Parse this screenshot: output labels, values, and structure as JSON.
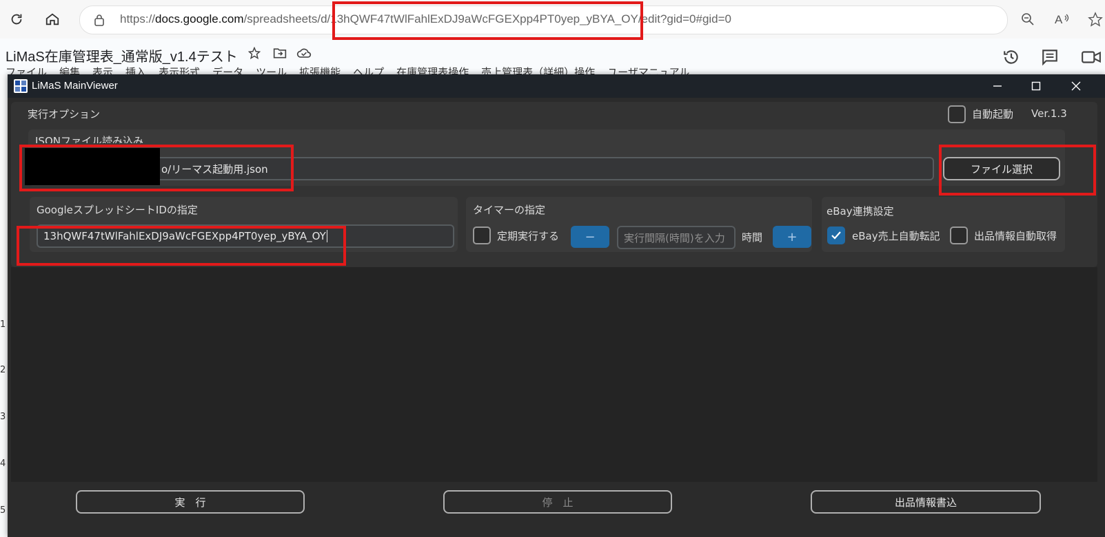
{
  "browser": {
    "url_prefix": "https://",
    "url_domain": "docs.google.com",
    "url_path_a": "/spreadsheets/d",
    "url_path_b": "/13hQWF47tWlFahlExDJ9aWcFGEXpp4PT0yep_yBYA_OY/edit?gid=0#gid=0",
    "icons": [
      "refresh-icon",
      "home-icon",
      "lock-icon",
      "zoom-out-icon",
      "read-aloud-icon",
      "favorite-icon"
    ]
  },
  "sheets": {
    "title": "LiMaS在庫管理表_通常版_v1.4テスト",
    "menu": [
      "ファイル",
      "編集",
      "表示",
      "挿入",
      "表示形式",
      "データ",
      "ツール",
      "拡張機能",
      "ヘルプ",
      "在庫管理表操作",
      "売上管理表（詳細）操作",
      "ユーザマニュアル"
    ],
    "row_numbers": [
      "1",
      "2",
      "3",
      "4",
      "5"
    ]
  },
  "window": {
    "title": "LiMaS MainViewer",
    "options_label": "実行オプション",
    "auto_start_label": "自動起動",
    "version": "Ver.1.3",
    "json_group_label": "JSONファイル読み込み",
    "json_path": "o/リーマス起動用.json",
    "file_select_label": "ファイル選択",
    "sheet_id_group_label": "GoogleスプレッドシートIDの指定",
    "sheet_id_value": "13hQWF47tWlFahlExDJ9aWcFGEXpp4PT0yep_yBYA_OY",
    "timer_group_label": "タイマーの指定",
    "periodic_label": "定期実行する",
    "minus_label": "−",
    "interval_placeholder": "実行間隔(時間)を入力",
    "hours_label": "時間",
    "plus_label": "+",
    "ebay_group_label": "eBay連携設定",
    "ebay_sales_label": "eBay売上自動転記",
    "listing_fetch_label": "出品情報自動取得",
    "run_label": "実　行",
    "stop_label": "停　止",
    "write_listing_label": "出品情報書込",
    "auto_start_checked": false,
    "periodic_checked": false,
    "ebay_sales_checked": true,
    "listing_fetch_checked": false
  },
  "colors": {
    "accent": "#1f6aa5",
    "highlight": "#e21a1a",
    "window_bg": "#2b2b2b"
  }
}
